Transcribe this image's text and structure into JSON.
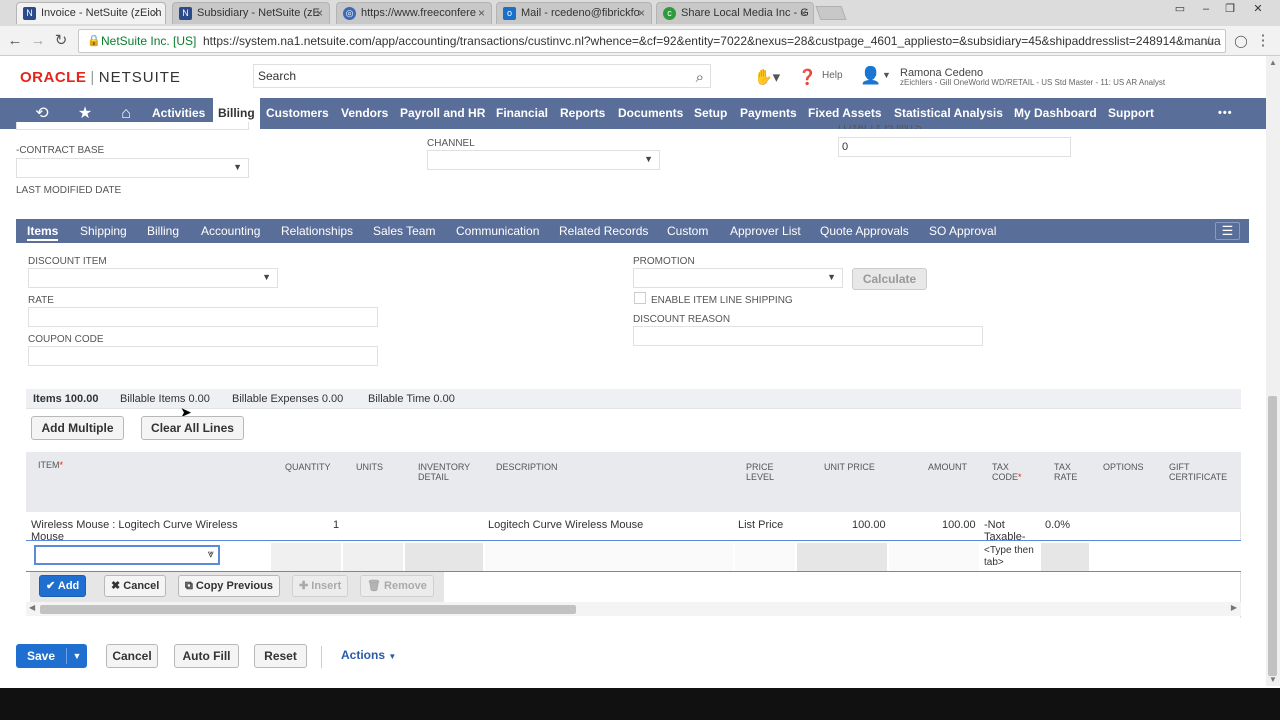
{
  "browser": {
    "tabs": [
      {
        "title": "Invoice - NetSuite (zEich",
        "icon": "netsuite-icon",
        "icon_color": "#2b4a8b"
      },
      {
        "title": "Subsidiary - NetSuite (zE",
        "icon": "netsuite-icon",
        "icon_color": "#2b4a8b"
      },
      {
        "title": "https://www.freeconfere",
        "icon": "globe-icon",
        "icon_color": "#3a6ab8"
      },
      {
        "title": "Mail - rcedeno@fibrickfo",
        "icon": "outlook-icon",
        "icon_color": "#1a6fc9"
      },
      {
        "title": "Share Local Media Inc - G",
        "icon": "share-icon",
        "icon_color": "#2e9a3c"
      }
    ],
    "close_glyph": "×",
    "secure_label": "NetSuite Inc. [US]",
    "url": "https://system.na1.netsuite.com/app/accounting/transactions/custinvc.nl?whence=&cf=92&entity=7022&nexus=28&custpage_4601_appliesto=&subsidiary=45&shipaddresslist=248914&manua"
  },
  "header": {
    "logo_oracle": "ORACLE",
    "logo_sep": "|",
    "logo_netsuite": "NETSUITE",
    "search_placeholder": "Search",
    "help_label": "Help",
    "user_name": "Ramona Cedeno",
    "user_role": "zEichlers - Gill OneWorld WD/RETAIL - US Std Master - 11: US AR Analyst"
  },
  "menu": {
    "items": [
      "Activities",
      "Billing",
      "Customers",
      "Vendors",
      "Payroll and HR",
      "Financial",
      "Reports",
      "Documents",
      "Setup",
      "Payments",
      "Fixed Assets",
      "Statistical Analysis",
      "My Dashboard",
      "Support"
    ],
    "more": "•••"
  },
  "form_top": {
    "contract_base_label": "-CONTRACT BASE",
    "last_modified_label": "LAST MODIFIED DATE",
    "channel_label": "CHANNEL",
    "loyalty_label": "LOYALTY POINTS",
    "loyalty_value": "0"
  },
  "subtabs": [
    "Items",
    "Shipping",
    "Billing",
    "Accounting",
    "Relationships",
    "Sales Team",
    "Communication",
    "Related Records",
    "Custom",
    "Approver List",
    "Quote Approvals",
    "SO Approval"
  ],
  "items_form": {
    "discount_item_label": "DISCOUNT ITEM",
    "rate_label": "RATE",
    "coupon_label": "COUPON CODE",
    "promotion_label": "PROMOTION",
    "calculate_label": "Calculate",
    "enable_shipping_label": "ENABLE ITEM LINE SHIPPING",
    "discount_reason_label": "DISCOUNT REASON"
  },
  "summary": [
    "Items 100.00",
    "Billable Items 0.00",
    "Billable Expenses 0.00",
    "Billable Time 0.00"
  ],
  "list_buttons": {
    "add_multiple": "Add Multiple",
    "clear_all": "Clear All Lines"
  },
  "grid": {
    "columns": [
      "ITEM",
      "QUANTITY",
      "UNITS",
      "INVENTORY DETAIL",
      "DESCRIPTION",
      "PRICE LEVEL",
      "UNIT PRICE",
      "AMOUNT",
      "TAX CODE",
      "TAX RATE",
      "OPTIONS",
      "GIFT CERTIFICATE"
    ],
    "required_mark": "*",
    "row": {
      "item": "Wireless Mouse : Logitech Curve Wireless Mouse",
      "quantity": "1",
      "description": "Logitech Curve Wireless Mouse",
      "price_level": "List Price",
      "unit_price": "100.00",
      "amount": "100.00",
      "tax_code": "-Not Taxable-",
      "tax_rate": "0.0%"
    },
    "edit_tax_hint": "<Type then tab>"
  },
  "row_buttons": {
    "add": "Add",
    "cancel": "Cancel",
    "copy_previous": "Copy Previous",
    "insert": "Insert",
    "remove": "Remove"
  },
  "footer": {
    "save": "Save",
    "cancel": "Cancel",
    "auto_fill": "Auto Fill",
    "reset": "Reset",
    "actions": "Actions"
  },
  "colors": {
    "menubar": "#5a6e9a",
    "primary": "#1f6fd1",
    "oracle_red": "#e2261c"
  }
}
